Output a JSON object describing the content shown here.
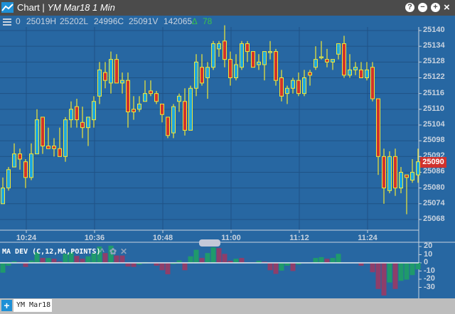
{
  "window": {
    "app": "Chart",
    "separator": "|",
    "symbol_title": "YM Mar18 1 Min",
    "buttons": [
      "?",
      "−",
      "+",
      "×"
    ]
  },
  "info": {
    "open": "0",
    "high": "25019H",
    "low": "25202L",
    "close": "24996C",
    "volume": "25091V",
    "last": "142065",
    "change_icon": "delta-up-icon",
    "change_symbol": "∆",
    "change": "78"
  },
  "colors": {
    "background": "#2767a2",
    "up_body": "#1ea7e0",
    "down_body": "#d0322d",
    "candle_outline": "#f2e936",
    "hist_up": "#1f9a6b",
    "hist_down": "#8e3e6a",
    "last_price_bg": "#d0322d"
  },
  "price_axis": {
    "labels": [
      "25140",
      "25134",
      "25128",
      "25122",
      "25116",
      "25110",
      "25104",
      "25098",
      "25092",
      "25086",
      "25080",
      "25074",
      "25068"
    ],
    "last_price": "25090"
  },
  "time_axis": {
    "labels": [
      "10:24",
      "10:36",
      "10:48",
      "11:00",
      "11:12",
      "11:24"
    ]
  },
  "indicator": {
    "title": "MA DEV (C,12,MA,POINTS)",
    "labels": [
      "20",
      "10",
      "0",
      "-10",
      "-20",
      "-30"
    ]
  },
  "tabs": {
    "add": "+",
    "items": [
      "YM Mar18"
    ]
  },
  "chart_data": [
    {
      "type": "candlestick",
      "title": "YM Mar18 1 Min",
      "ylim": [
        25066,
        25144
      ],
      "ohlc": [
        [
          25074,
          25084,
          25074,
          25080
        ],
        [
          25080,
          25088,
          25079,
          25087
        ],
        [
          25088,
          25097,
          25088,
          25093
        ],
        [
          25093,
          25095,
          25087,
          25091
        ],
        [
          25090,
          25091,
          25080,
          25084
        ],
        [
          25084,
          25097,
          25083,
          25093
        ],
        [
          25093,
          25110,
          25093,
          25106
        ],
        [
          25107,
          25107,
          25093,
          25096
        ],
        [
          25096,
          25103,
          25095,
          25095
        ],
        [
          25096,
          25099,
          25092,
          25095
        ],
        [
          25095,
          25103,
          25092,
          25092
        ],
        [
          25092,
          25107,
          25090,
          25106
        ],
        [
          25106,
          25113,
          25103,
          25110
        ],
        [
          25111,
          25114,
          25103,
          25106
        ],
        [
          25105,
          25111,
          25099,
          25103
        ],
        [
          25103,
          25107,
          25096,
          25107
        ],
        [
          25106,
          25115,
          25103,
          25113
        ],
        [
          25115,
          25128,
          25112,
          25125
        ],
        [
          25124,
          25128,
          25118,
          25121
        ],
        [
          25120,
          25132,
          25116,
          25129
        ],
        [
          25129,
          25131,
          25120,
          25120
        ],
        [
          25120,
          25124,
          25116,
          25121
        ],
        [
          25121,
          25124,
          25103,
          25109
        ],
        [
          25110,
          25115,
          25106,
          25109
        ],
        [
          25110,
          25115,
          25109,
          25112
        ],
        [
          25113,
          25121,
          25113,
          25116
        ],
        [
          25117,
          25121,
          25115,
          25116
        ],
        [
          25116,
          25117,
          25112,
          25113
        ],
        [
          25112,
          25112,
          25105,
          25108
        ],
        [
          25107,
          25107,
          25099,
          25100
        ],
        [
          25101,
          25112,
          25099,
          25111
        ],
        [
          25113,
          25116,
          25109,
          25115
        ],
        [
          25113,
          25118,
          25100,
          25102
        ],
        [
          25102,
          25119,
          25102,
          25118
        ],
        [
          25118,
          25131,
          25115,
          25128
        ],
        [
          25126,
          25131,
          25119,
          25120
        ],
        [
          25122,
          25128,
          25114,
          25126
        ],
        [
          25126,
          25136,
          25125,
          25135
        ],
        [
          25133,
          25136,
          25130,
          25135
        ],
        [
          25136,
          25142,
          25126,
          25129
        ],
        [
          25129,
          25132,
          25119,
          25122
        ],
        [
          25122,
          25131,
          25121,
          25127
        ],
        [
          25126,
          25136,
          25125,
          25135
        ],
        [
          25135,
          25136,
          25128,
          25132
        ],
        [
          25132,
          25132,
          25126,
          25126
        ],
        [
          25127,
          25131,
          25125,
          25128
        ],
        [
          25127,
          25132,
          25121,
          25132
        ],
        [
          25132,
          25136,
          25129,
          25132
        ],
        [
          25132,
          25133,
          25119,
          25121
        ],
        [
          25122,
          25125,
          25113,
          25115
        ],
        [
          25116,
          25119,
          25112,
          25118
        ],
        [
          25118,
          25122,
          25116,
          25121
        ],
        [
          25121,
          25124,
          25115,
          25116
        ],
        [
          25116,
          25125,
          25115,
          25122
        ],
        [
          25124,
          25125,
          25119,
          25123
        ],
        [
          25126,
          25134,
          25125,
          25129
        ],
        [
          25130,
          25136,
          25129,
          25130
        ],
        [
          25129,
          25133,
          25126,
          25128
        ],
        [
          25128,
          25129,
          25125,
          25129
        ],
        [
          25131,
          25135,
          25129,
          25135
        ],
        [
          25135,
          25138,
          25122,
          25123
        ],
        [
          25123,
          25131,
          25122,
          25125
        ],
        [
          25125,
          25128,
          25123,
          25126
        ],
        [
          25125,
          25128,
          25122,
          25122
        ],
        [
          25122,
          25128,
          25121,
          25125
        ],
        [
          25126,
          25128,
          25113,
          25114
        ],
        [
          25114,
          25114,
          25085,
          25092
        ],
        [
          25092,
          25095,
          25074,
          25080
        ],
        [
          25079,
          25094,
          25078,
          25092
        ],
        [
          25092,
          25095,
          25077,
          25080
        ],
        [
          25080,
          25088,
          25078,
          25086
        ],
        [
          25085,
          25085,
          25070,
          25084
        ],
        [
          25083,
          25091,
          25082,
          25086
        ],
        [
          25085,
          25095,
          25082,
          25090
        ]
      ]
    },
    {
      "type": "bar",
      "title": "MA DEV (C,12,MA,POINTS)",
      "ylim": [
        -40,
        25
      ],
      "values": [
        -12,
        -3.5,
        2,
        1,
        -5,
        3,
        13,
        6,
        6,
        5,
        1.5,
        11,
        13,
        8.5,
        5,
        8,
        12,
        20,
        12,
        21,
        9,
        9,
        -4.5,
        -5,
        -2,
        1,
        0.5,
        -3.5,
        -9,
        -14,
        -1.5,
        3,
        -9,
        8,
        16,
        6,
        12,
        19,
        18,
        11,
        2.5,
        5,
        6,
        -0.5,
        0.5,
        2.5,
        1.5,
        -9,
        -13.5,
        -9.5,
        -3.5,
        -10,
        -2,
        0.5,
        0.5,
        6,
        7,
        5,
        6,
        11,
        0.5,
        0.5,
        0.3,
        -3.5,
        -0.5,
        -11.5,
        -32,
        -40,
        -24,
        -32,
        -22,
        -20.5,
        -15,
        -8
      ],
      "colors": [
        "g",
        "g",
        "g",
        "p",
        "p",
        "g",
        "g",
        "p",
        "g",
        "p",
        "p",
        "g",
        "g",
        "p",
        "p",
        "g",
        "g",
        "g",
        "p",
        "g",
        "p",
        "p",
        "p",
        "p",
        "g",
        "g",
        "p",
        "p",
        "p",
        "p",
        "g",
        "g",
        "p",
        "g",
        "g",
        "p",
        "g",
        "g",
        "p",
        "p",
        "p",
        "g",
        "p",
        "p",
        "p",
        "g",
        "p",
        "p",
        "p",
        "g",
        "g",
        "p",
        "g",
        "g",
        "g",
        "g",
        "g",
        "p",
        "g",
        "g",
        "g",
        "g",
        "g",
        "p",
        "g",
        "p",
        "p",
        "p",
        "g",
        "p",
        "g",
        "g",
        "g",
        "g"
      ]
    }
  ]
}
